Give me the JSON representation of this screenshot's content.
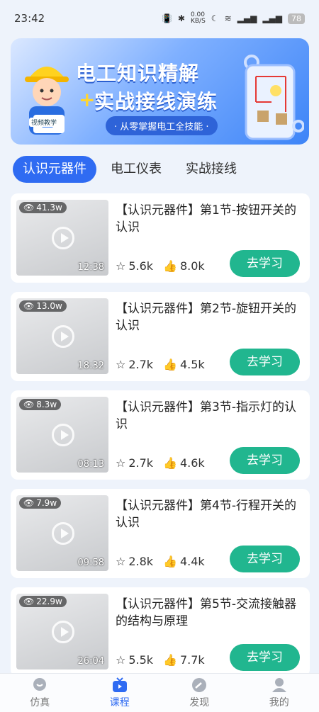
{
  "status": {
    "time": "23:42",
    "net": "0.00\nKB/S",
    "battery": "78"
  },
  "banner": {
    "title1": "电工知识精解",
    "title2": "实战接线演练",
    "subtitle": "· 从零掌握电工全技能 ·",
    "badge": "视频教学"
  },
  "tabs": [
    {
      "label": "认识元器件",
      "active": true
    },
    {
      "label": "电工仪表",
      "active": false
    },
    {
      "label": "实战接线",
      "active": false
    }
  ],
  "items": [
    {
      "title": "【认识元器件】第1节-按钮开关的认识",
      "views": "41.3w",
      "duration": "12:38",
      "stars": "5.6k",
      "likes": "8.0k",
      "button": "去学习"
    },
    {
      "title": "【认识元器件】第2节-旋钮开关的认识",
      "views": "13.0w",
      "duration": "18:32",
      "stars": "2.7k",
      "likes": "4.5k",
      "button": "去学习"
    },
    {
      "title": "【认识元器件】第3节-指示灯的认识",
      "views": "8.3w",
      "duration": "08:13",
      "stars": "2.7k",
      "likes": "4.6k",
      "button": "去学习"
    },
    {
      "title": "【认识元器件】第4节-行程开关的认识",
      "views": "7.9w",
      "duration": "09:58",
      "stars": "2.8k",
      "likes": "4.4k",
      "button": "去学习"
    },
    {
      "title": "【认识元器件】第5节-交流接触器的结构与原理",
      "views": "22.9w",
      "duration": "26:04",
      "stars": "5.5k",
      "likes": "7.7k",
      "button": "去学习"
    }
  ],
  "nav": [
    {
      "label": "仿真",
      "icon": "chat-bubble-icon",
      "active": false
    },
    {
      "label": "课程",
      "icon": "tv-icon",
      "active": true
    },
    {
      "label": "发现",
      "icon": "compass-icon",
      "active": false
    },
    {
      "label": "我的",
      "icon": "user-icon",
      "active": false
    }
  ],
  "colors": {
    "primary": "#2f6bf2",
    "learn": "#21b68f"
  }
}
